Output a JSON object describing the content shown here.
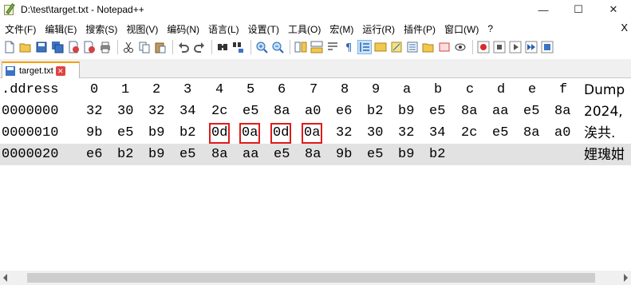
{
  "window": {
    "title": "D:\\test\\target.txt - Notepad++",
    "minimize": "—",
    "maximize": "☐",
    "close": "✕"
  },
  "menu": {
    "items": [
      "文件(F)",
      "编辑(E)",
      "搜索(S)",
      "视图(V)",
      "编码(N)",
      "语言(L)",
      "设置(T)",
      "工具(O)",
      "宏(M)",
      "运行(R)",
      "插件(P)",
      "窗口(W)",
      "?"
    ],
    "close": "X"
  },
  "toolbar": {
    "icons": [
      "new-file-icon",
      "open-file-icon",
      "save-icon",
      "save-all-icon",
      "close-icon",
      "close-all-icon",
      "print-icon",
      "cut-icon",
      "copy-icon",
      "paste-icon",
      "undo-icon",
      "redo-icon",
      "find-icon",
      "replace-icon",
      "zoom-in-icon",
      "zoom-out-icon",
      "sync-vertical-icon",
      "sync-horizontal-icon",
      "word-wrap-icon",
      "show-all-chars-icon",
      "indent-guide-icon",
      "udl-icon",
      "doc-map-icon",
      "function-list-icon",
      "folder-workspace-icon",
      "monitor-icon",
      "record-macro-icon",
      "stop-record-icon",
      "play-macro-icon",
      "run-multiple-icon",
      "save-macro-icon"
    ]
  },
  "tab": {
    "label": "target.txt",
    "close": "✕"
  },
  "hex": {
    "header": {
      "address": ".ddress",
      "cols": [
        "0",
        "1",
        "2",
        "3",
        "4",
        "5",
        "6",
        "7",
        "8",
        "9",
        "a",
        "b",
        "c",
        "d",
        "e",
        "f"
      ],
      "dump": "Dump"
    },
    "rows": [
      {
        "address": "0000000",
        "bytes": [
          "32",
          "30",
          "32",
          "34",
          "2c",
          "e5",
          "8a",
          "a0",
          "e6",
          "b2",
          "b9",
          "e5",
          "8a",
          "aa",
          "e5",
          "8a"
        ],
        "dump": "2024,"
      },
      {
        "address": "0000010",
        "bytes": [
          "9b",
          "e5",
          "b9",
          "b2",
          "0d",
          "0a",
          "0d",
          "0a",
          "32",
          "30",
          "32",
          "34",
          "2c",
          "e5",
          "8a",
          "a0"
        ],
        "dump": "涘共."
      },
      {
        "address": "0000020",
        "bytes": [
          "e6",
          "b2",
          "b9",
          "e5",
          "8a",
          "aa",
          "e5",
          "8a",
          "9b",
          "e5",
          "b9",
          "b2",
          "",
          "",
          "",
          ""
        ],
        "dump": "娌瑰姏"
      }
    ],
    "highlighted": [
      {
        "row": 1,
        "col": 4
      },
      {
        "row": 1,
        "col": 5
      },
      {
        "row": 1,
        "col": 6
      },
      {
        "row": 1,
        "col": 7
      }
    ],
    "highlight_color": "#e01b1b",
    "alt_row_color": "#e2e2e2"
  }
}
